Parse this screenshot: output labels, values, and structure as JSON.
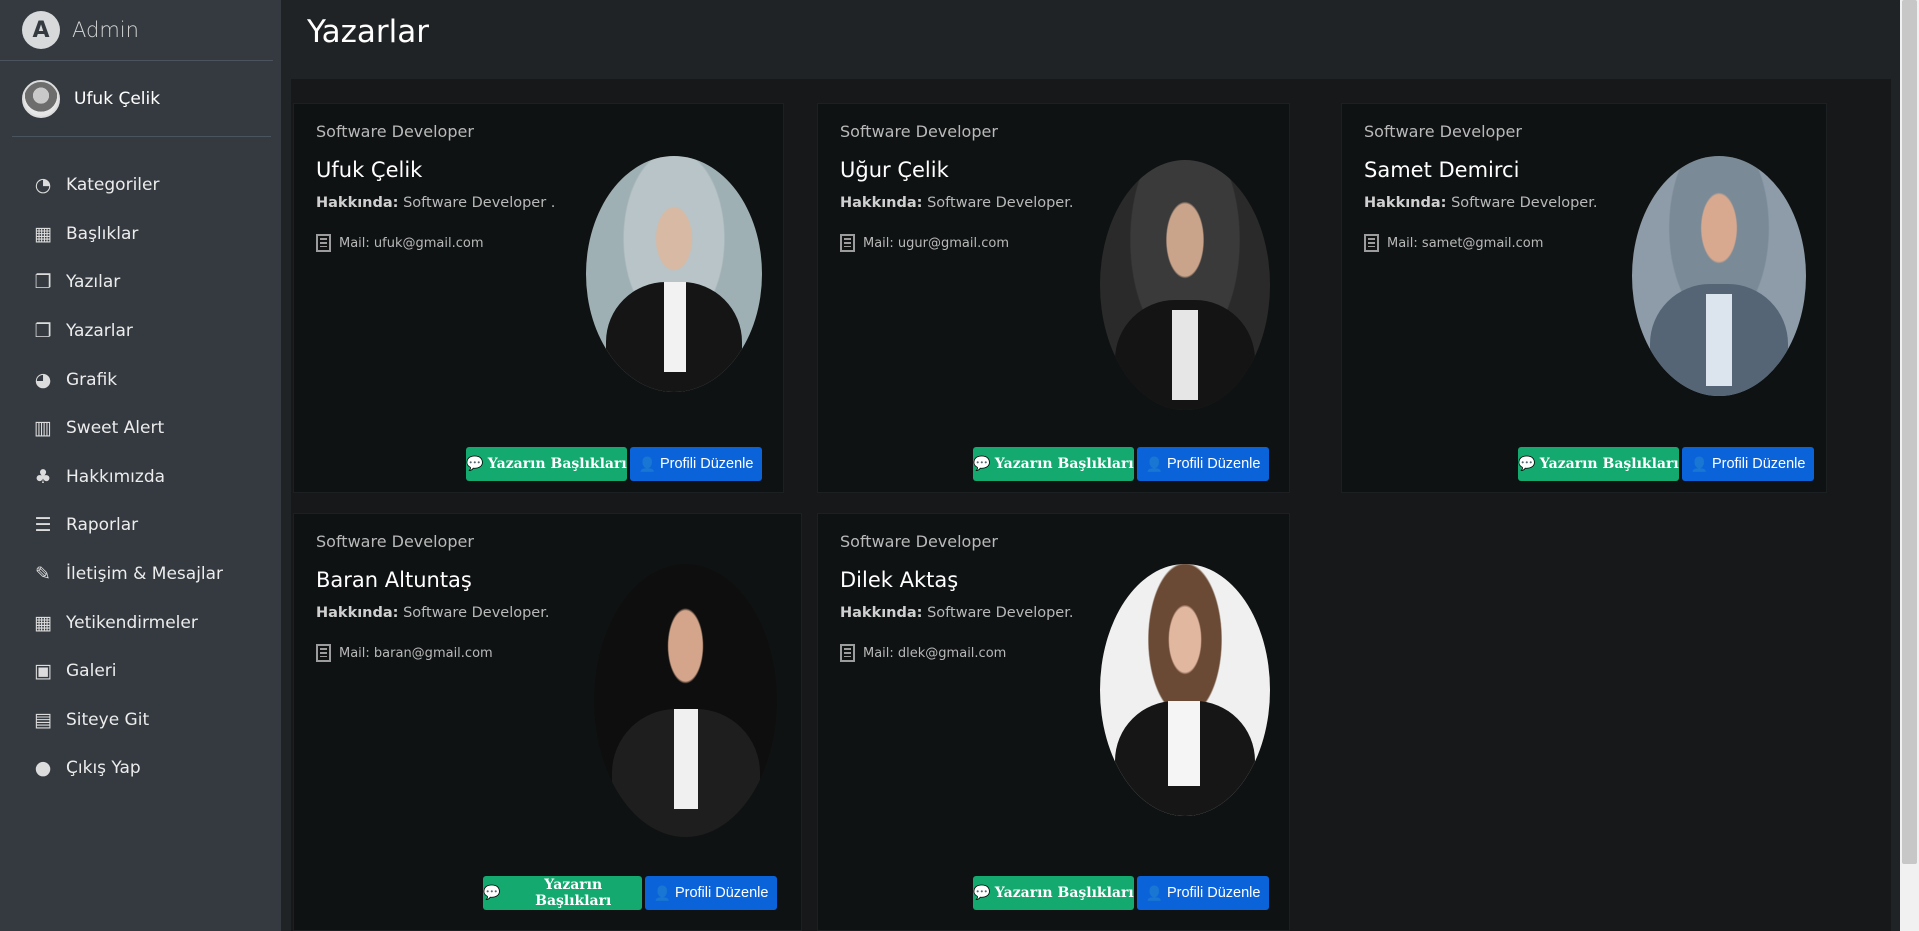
{
  "brand": {
    "logo": "A",
    "name": "Admin"
  },
  "user": {
    "name": "Ufuk Çelik"
  },
  "nav": [
    {
      "label": "Kategoriler",
      "icon": "tachometer-icon",
      "glyph": "◔"
    },
    {
      "label": "Başlıklar",
      "icon": "grid-icon",
      "glyph": "▦"
    },
    {
      "label": "Yazılar",
      "icon": "copy-icon",
      "glyph": "❐"
    },
    {
      "label": "Yazarlar",
      "icon": "copy-icon",
      "glyph": "❐"
    },
    {
      "label": "Grafik",
      "icon": "pie-chart-icon",
      "glyph": "◕"
    },
    {
      "label": "Sweet Alert",
      "icon": "map-icon",
      "glyph": "▥"
    },
    {
      "label": "Hakkımızda",
      "icon": "tree-icon",
      "glyph": "♣"
    },
    {
      "label": "Raporlar",
      "icon": "bars-icon",
      "glyph": "☰"
    },
    {
      "label": "İletişim & Mesajlar",
      "icon": "edit-icon",
      "glyph": "✎"
    },
    {
      "label": "Yetikendirmeler",
      "icon": "calendar-icon",
      "glyph": "▦"
    },
    {
      "label": "Galeri",
      "icon": "image-icon",
      "glyph": "▣"
    },
    {
      "label": "Siteye Git",
      "icon": "file-icon",
      "glyph": "▤"
    },
    {
      "label": "Çıkış Yap",
      "icon": "apple-icon",
      "glyph": "●"
    }
  ],
  "page": {
    "title": "Yazarlar"
  },
  "labels": {
    "about": "Hakkında:",
    "posts_button": "Yazarın Başlıkları",
    "edit_button": "Profili Düzenle"
  },
  "writers": [
    {
      "role": "Software Developer",
      "name": "Ufuk Çelik",
      "about": "Software Developer .",
      "mail": "Mail: ufuk@gmail.com"
    },
    {
      "role": "Software Developer",
      "name": "Uğur Çelik",
      "about": "Software Developer.",
      "mail": "Mail: ugur@gmail.com"
    },
    {
      "role": "Software Developer",
      "name": "Samet Demirci",
      "about": "Software Developer.",
      "mail": "Mail: samet@gmail.com"
    },
    {
      "role": "Software Developer",
      "name": "Baran Altuntaş",
      "about": "Software Developer.",
      "mail": "Mail: baran@gmail.com"
    },
    {
      "role": "Software Developer",
      "name": "Dilek Aktaş",
      "about": "Software Developer.",
      "mail": "Mail: dlek@gmail.com"
    }
  ],
  "colors": {
    "sidebar": "#343a40",
    "posts_button": "#14a96f",
    "edit_button": "#0b63d9"
  }
}
